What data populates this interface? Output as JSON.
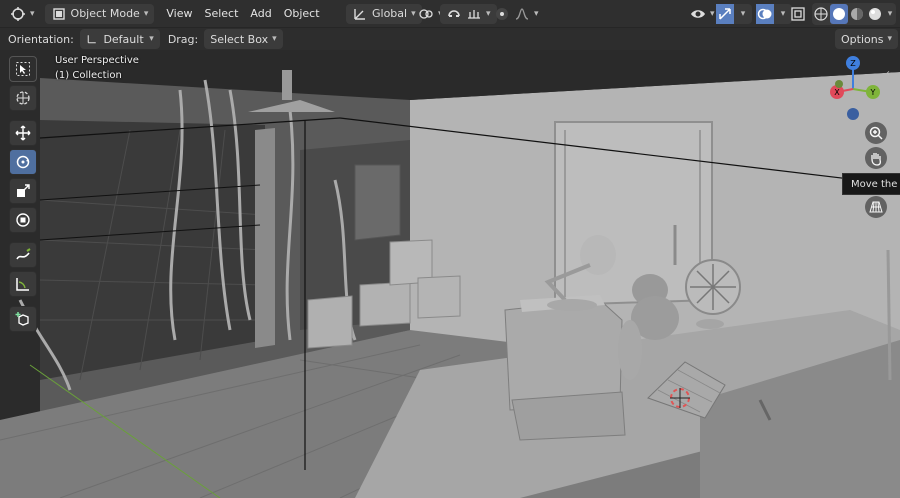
{
  "header": {
    "mode_label": "Object Mode",
    "menus": [
      "View",
      "Select",
      "Add",
      "Object"
    ],
    "transform_orientation": "Global",
    "icons": [
      "editor-type-icon",
      "object-mode-icon",
      "transform-orientation-icon",
      "pivot-icon",
      "snap-icon",
      "proportional-edit-icon",
      "visibility-icon",
      "gizmo-icon",
      "overlay-icon",
      "xray-icon",
      "shading-wireframe-icon",
      "shading-solid-icon",
      "shading-material-icon",
      "shading-rendered-icon"
    ]
  },
  "toolsettings": {
    "orientation_label": "Orientation:",
    "orientation_value": "Default",
    "drag_label": "Drag:",
    "drag_value": "Select Box",
    "options_label": "Options"
  },
  "viewport": {
    "view_name": "User Perspective",
    "collection_name": "(1) Collection",
    "tooltip": "Move the view",
    "gizmo_axes": [
      "Z",
      "Y",
      "X"
    ],
    "colors": {
      "x_axis": "#e04a5a",
      "y_axis": "#7fb43a",
      "z_axis": "#3f7fde",
      "active_tool": "#4f6f9f"
    }
  },
  "tools": [
    "select-box-tool",
    "cursor-tool",
    "move-tool",
    "rotate-tool",
    "scale-tool",
    "transform-tool",
    "annotate-tool",
    "measure-tool",
    "add-cube-tool"
  ]
}
